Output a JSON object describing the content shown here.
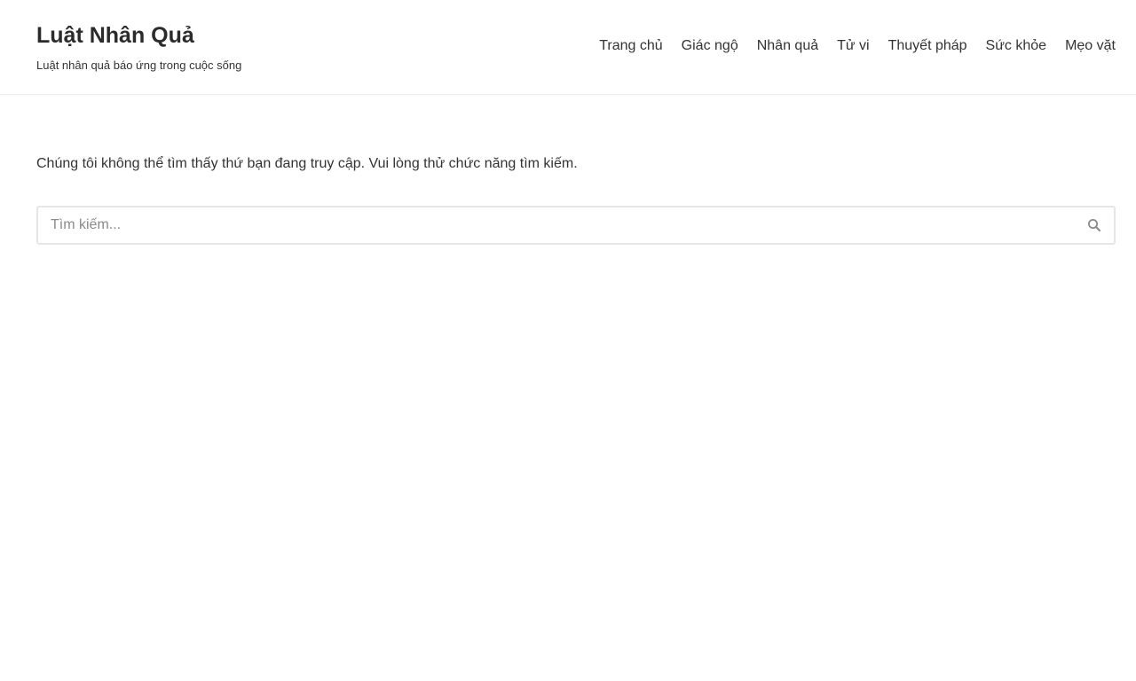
{
  "site": {
    "title": "Luật Nhân Quả",
    "description": "Luật nhân quả báo ứng trong cuộc sống"
  },
  "nav": {
    "items": [
      {
        "label": "Trang chủ"
      },
      {
        "label": "Giác ngộ"
      },
      {
        "label": "Nhân quả"
      },
      {
        "label": "Tử vi"
      },
      {
        "label": "Thuyết pháp"
      },
      {
        "label": "Sức khỏe"
      },
      {
        "label": "Mẹo vặt"
      }
    ]
  },
  "main": {
    "notice": "Chúng tôi không thể tìm thấy thứ bạn đang truy cập. Vui lòng thử chức năng tìm kiếm.",
    "search": {
      "placeholder": "Tìm kiếm...",
      "value": "",
      "icon": "search-icon"
    }
  },
  "colors": {
    "text": "#2b2b2b",
    "border": "#e6e6e6",
    "icon": "#8a8a8a"
  }
}
